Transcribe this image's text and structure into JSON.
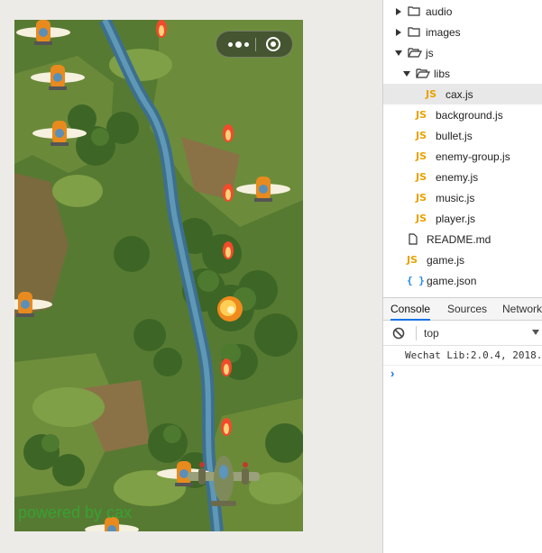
{
  "simulator": {
    "menu_capsule": {
      "more_icon": "more-dots-icon",
      "close_icon": "record-close-icon"
    },
    "watermark": "powered by cax"
  },
  "file_tree": {
    "items": [
      {
        "name": "audio",
        "kind": "folder",
        "expanded": false
      },
      {
        "name": "images",
        "kind": "folder",
        "expanded": false
      },
      {
        "name": "js",
        "kind": "folder",
        "expanded": true
      },
      {
        "name": "libs",
        "kind": "folder",
        "expanded": true
      },
      {
        "name": "cax.js",
        "kind": "js",
        "selected": true
      },
      {
        "name": "background.js",
        "kind": "js"
      },
      {
        "name": "bullet.js",
        "kind": "js"
      },
      {
        "name": "enemy-group.js",
        "kind": "js"
      },
      {
        "name": "enemy.js",
        "kind": "js"
      },
      {
        "name": "music.js",
        "kind": "js"
      },
      {
        "name": "player.js",
        "kind": "js"
      },
      {
        "name": "README.md",
        "kind": "file"
      },
      {
        "name": "game.js",
        "kind": "js"
      },
      {
        "name": "game.json",
        "kind": "json"
      }
    ],
    "js_badge": "JS",
    "json_badge": "{ }"
  },
  "console": {
    "tabs": [
      "Console",
      "Sources",
      "Network"
    ],
    "active_tab": "Console",
    "context": "top",
    "log": "Wechat Lib:2.0.4, 2018.",
    "prompt": "›"
  },
  "colors": {
    "accent": "#1a73e8",
    "js_icon": "#e8a200",
    "json_icon": "#1e88e5",
    "watermark": "#33a833"
  }
}
